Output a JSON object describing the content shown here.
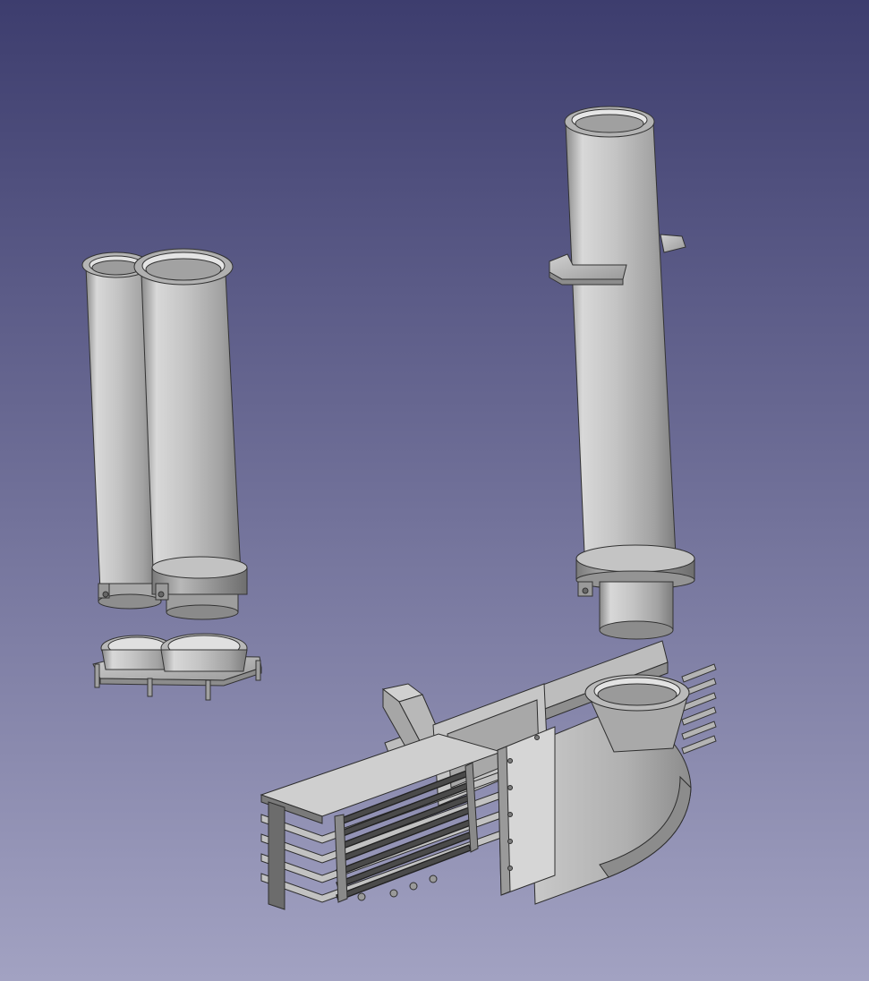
{
  "viewport": {
    "background_top": "#3d3d6e",
    "background_bottom": "#a2a2c2"
  },
  "model": {
    "color": "#bebebe",
    "parts": [
      {
        "name": "twin-short-pipes"
      },
      {
        "name": "twin-pipe-flange-base"
      },
      {
        "name": "tall-pipe-with-bracket"
      },
      {
        "name": "manifold-box-assembly"
      },
      {
        "name": "elbow-duct"
      }
    ]
  }
}
